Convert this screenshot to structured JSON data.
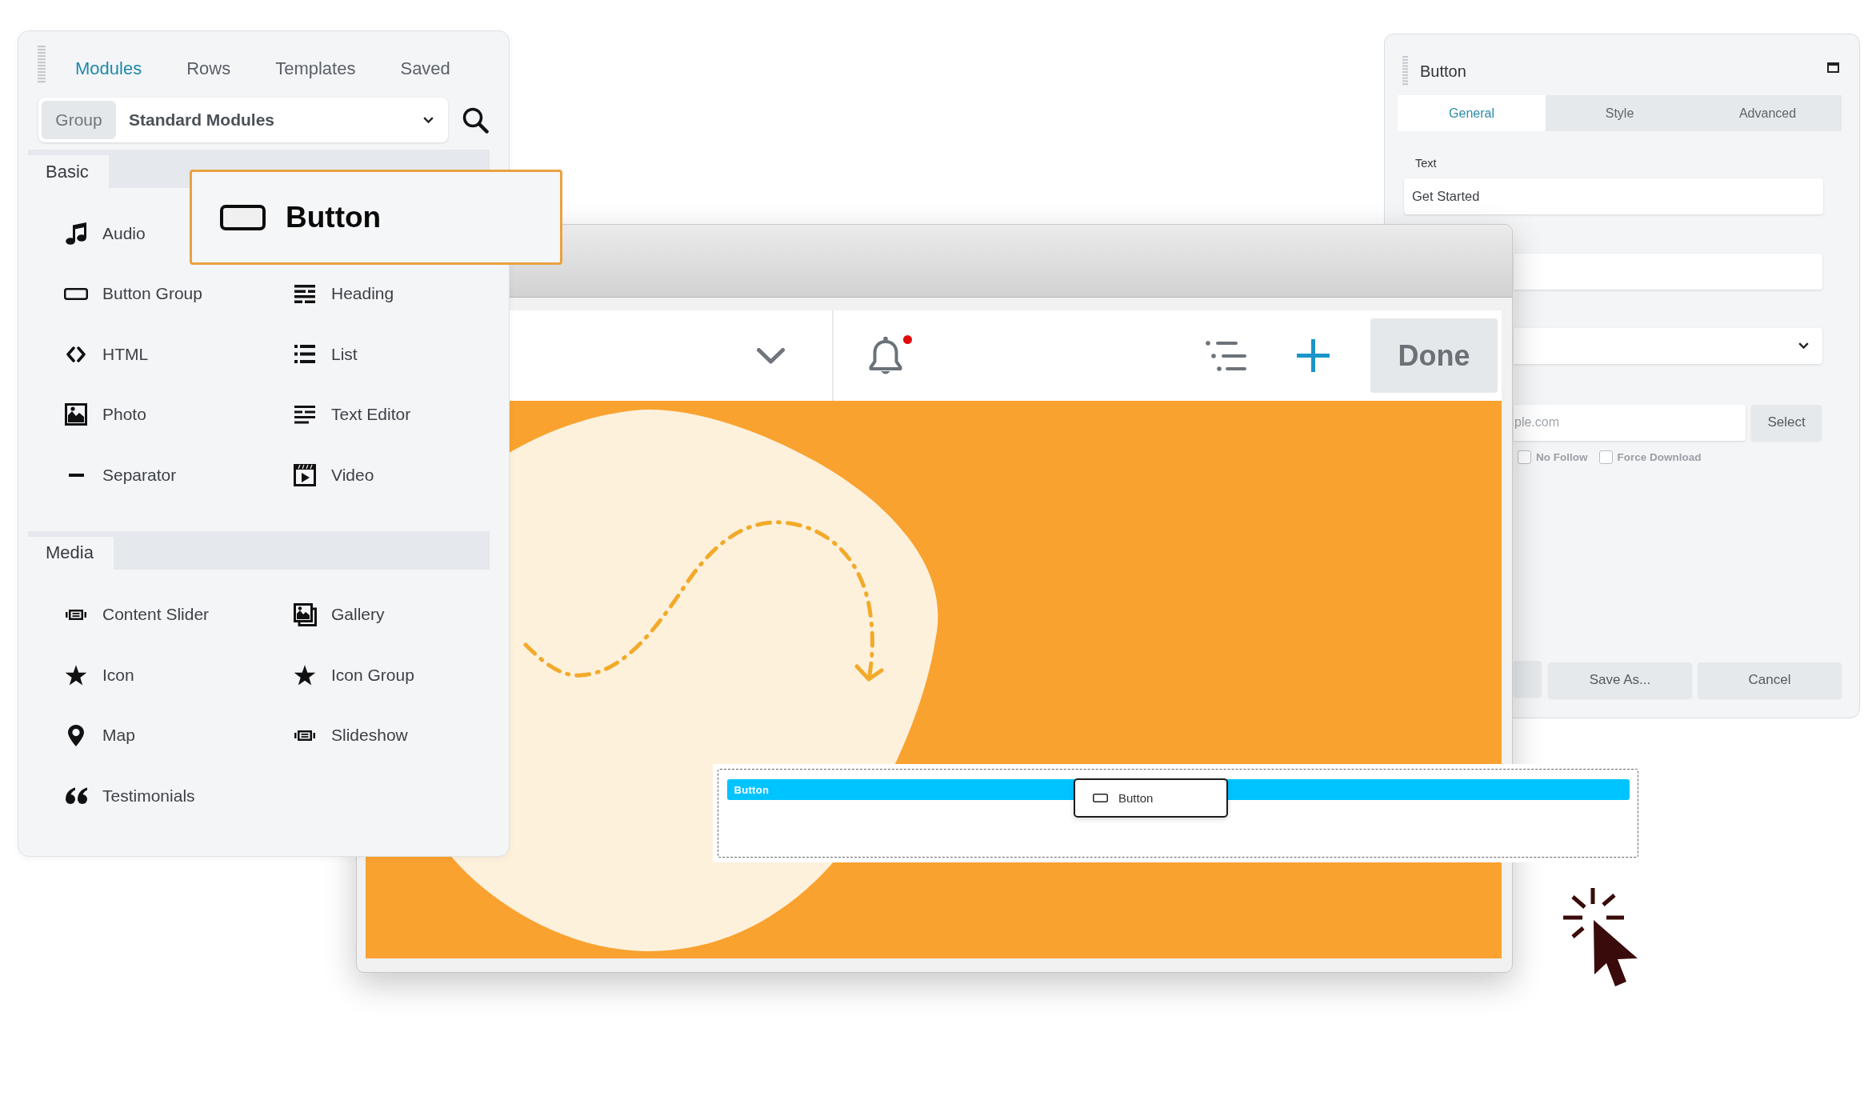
{
  "modules_panel": {
    "tabs": [
      {
        "label": "Modules",
        "selected": true
      },
      {
        "label": "Rows",
        "selected": false
      },
      {
        "label": "Templates",
        "selected": false
      },
      {
        "label": "Saved",
        "selected": false
      }
    ],
    "group_select": {
      "label": "Group",
      "value": "Standard Modules"
    },
    "sections": [
      {
        "title": "Basic",
        "rows": [
          [
            {
              "label": "Audio",
              "kind": "music"
            }
          ],
          [
            {
              "label": "Button Group",
              "kind": "button"
            },
            {
              "label": "Heading",
              "kind": "heading"
            }
          ],
          [
            {
              "label": "HTML",
              "kind": "code"
            },
            {
              "label": "List",
              "kind": "list"
            }
          ],
          [
            {
              "label": "Photo",
              "kind": "photo"
            },
            {
              "label": "Text Editor",
              "kind": "text"
            }
          ],
          [
            {
              "label": "Separator",
              "kind": "separator"
            },
            {
              "label": "Video",
              "kind": "video"
            }
          ]
        ]
      },
      {
        "title": "Media",
        "rows": [
          [
            {
              "label": "Content Slider",
              "kind": "slider"
            },
            {
              "label": "Gallery",
              "kind": "gallery"
            }
          ],
          [
            {
              "label": "Icon",
              "kind": "star"
            },
            {
              "label": "Icon Group",
              "kind": "star"
            }
          ],
          [
            {
              "label": "Map",
              "kind": "pin"
            },
            {
              "label": "Slideshow",
              "kind": "slider"
            }
          ],
          [
            {
              "label": "Testimonials",
              "kind": "quote"
            }
          ]
        ]
      }
    ]
  },
  "dragged_module": {
    "label": "Button"
  },
  "settings_panel": {
    "title": "Button",
    "tabs": [
      {
        "label": "General",
        "selected": true
      },
      {
        "label": "Style",
        "selected": false
      },
      {
        "label": "Advanced",
        "selected": false
      }
    ],
    "text_field": {
      "label": "Text",
      "value": "Get Started"
    },
    "link_field": {
      "placeholder": "ple.com",
      "button": "Select"
    },
    "options": [
      {
        "label": "No Follow",
        "checked": false
      },
      {
        "label": "Force Download",
        "checked": false
      }
    ],
    "footer_buttons": [
      "Save As...",
      "Cancel"
    ]
  },
  "editor_window": {
    "notification": true,
    "done_button": "Done"
  },
  "drop_zone": {
    "row_label": "Button",
    "preview_label": "Button"
  }
}
